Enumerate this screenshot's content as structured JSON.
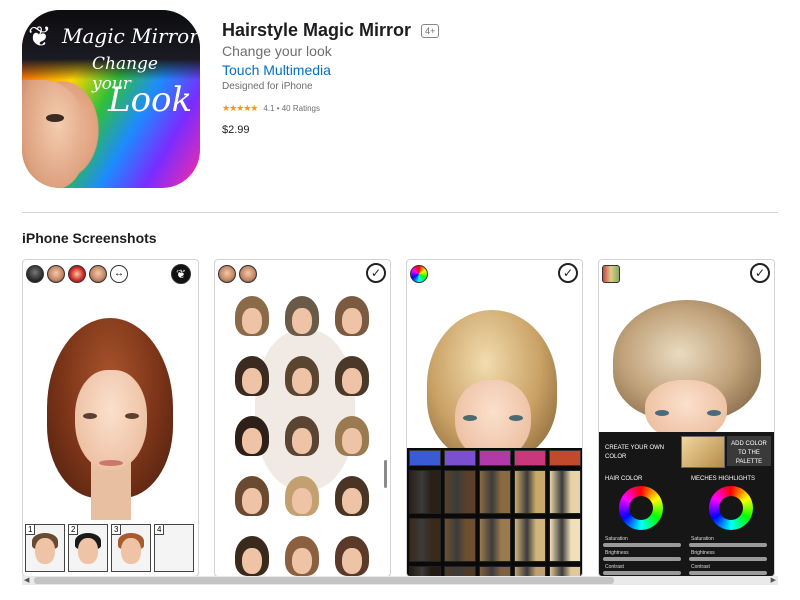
{
  "app": {
    "icon_text": [
      "Magic Mirror",
      "Change your",
      "Look"
    ],
    "title": "Hairstyle Magic Mirror",
    "age_rating": "4+",
    "subtitle": "Change your look",
    "developer": "Touch Multimedia",
    "designed_for": "Designed for iPhone",
    "rating_stars": "★★★★★",
    "rating_value": "4.1",
    "ratings_count": "40 Ratings",
    "price": "$2.99"
  },
  "screenshots": {
    "section_title": "iPhone Screenshots",
    "shot1": {
      "thumbnail_numbers": [
        "1",
        "2",
        "3",
        "4"
      ]
    },
    "shot3": {
      "swatch_colors": [
        "#3b5bd6",
        "#7a4fd0",
        "#b03aa8",
        "#c9387a",
        "#c24a2c"
      ],
      "tile_colors": [
        "#2a2018",
        "#5a4028",
        "#8a6a40",
        "#c9a86a",
        "#e7d3a6",
        "#3a2a1c",
        "#6e5030",
        "#9a7a4e",
        "#d2b47e",
        "#f0e0b8",
        "#241a12",
        "#4e3a26",
        "#806040",
        "#bfa070",
        "#e0c89a"
      ]
    },
    "shot4": {
      "create_own": "CREATE YOUR OWN COLOR",
      "add_color": "ADD COLOR TO THE PALETTE",
      "hair_color": "HAIR COLOR",
      "meches": "MECHES HIGHLIGHTS",
      "saturation": "Saturation",
      "brightness": "Brightness",
      "contrast": "Contrast"
    }
  },
  "colors": {
    "link": "#0070c9",
    "star": "#ff9500"
  }
}
